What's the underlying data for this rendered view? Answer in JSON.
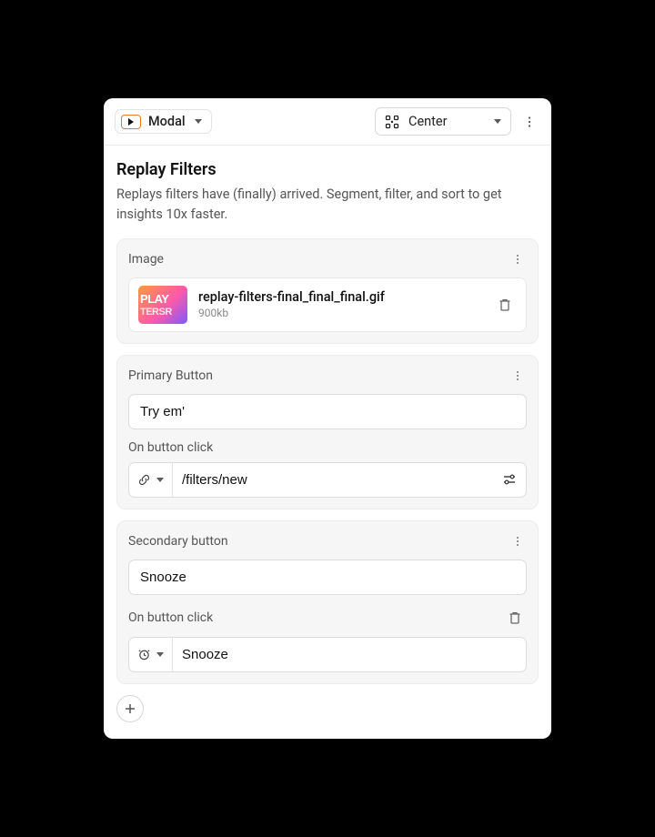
{
  "topbar": {
    "type_label": "Modal",
    "align_label": "Center"
  },
  "header": {
    "title": "Replay Filters",
    "subtitle": "Replays filters have (finally) arrived. Segment, filter, and sort to get insights 10x faster."
  },
  "image_section": {
    "label": "Image",
    "file_name": "replay-filters-final_final_final.gif",
    "file_size": "900kb",
    "thumb_text_1": "PLAY",
    "thumb_text_2": "TERSR"
  },
  "primary_button": {
    "label": "Primary Button",
    "value": "Try em'",
    "click_label": "On button click",
    "click_value": "/filters/new"
  },
  "secondary_button": {
    "label": "Secondary button",
    "value": "Snooze",
    "click_label": "On button click",
    "click_value": "Snooze"
  }
}
